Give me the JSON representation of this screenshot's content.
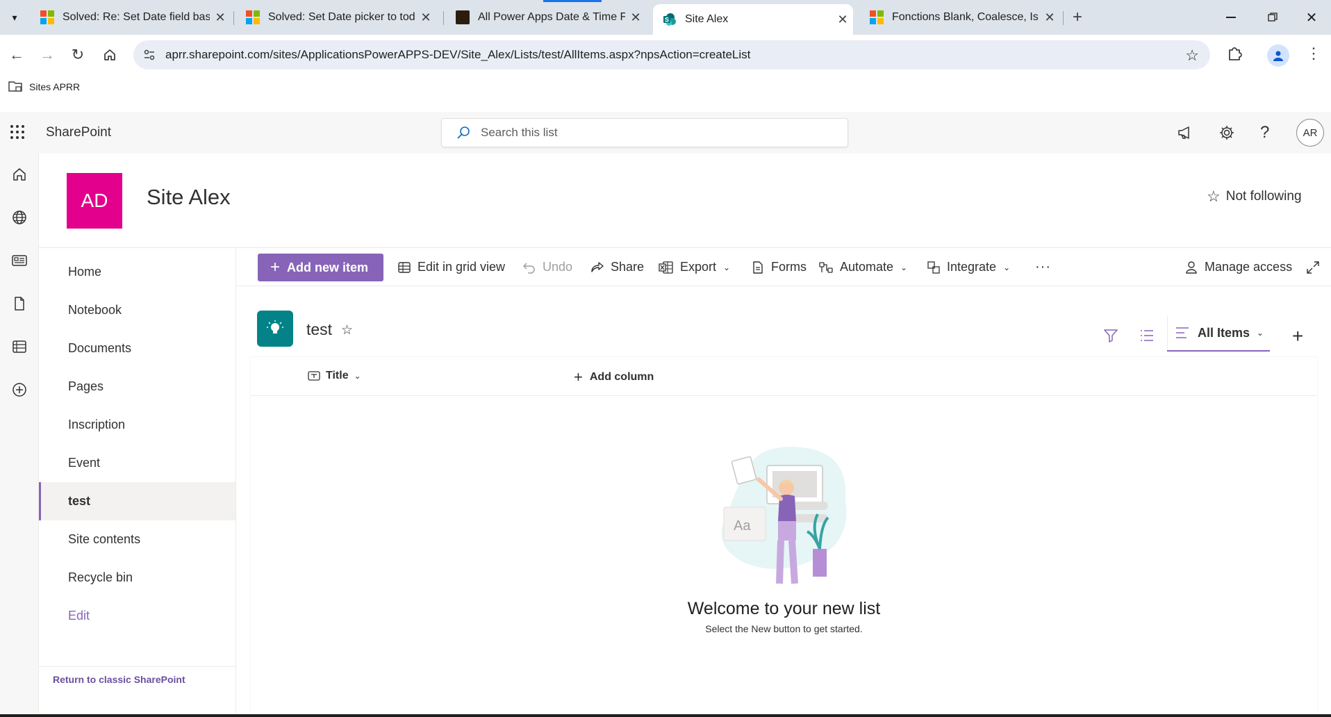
{
  "browser": {
    "tabs": [
      {
        "title": "Solved: Re: Set Date field based",
        "favicon": "microsoft-logo"
      },
      {
        "title": "Solved: Set Date picker to today",
        "favicon": "microsoft-logo"
      },
      {
        "title": "All Power Apps Date & Time Fu",
        "favicon": "site-favicon"
      },
      {
        "title": "Site Alex",
        "favicon": "sharepoint-logo"
      },
      {
        "title": "Fonctions Blank, Coalesce, IsBla",
        "favicon": "microsoft-logo"
      }
    ],
    "active_tab": 3,
    "url": "aprr.sharepoint.com/sites/ApplicationsPowerAPPS-DEV/Site_Alex/Lists/test/AllItems.aspx?npsAction=createList",
    "bookmark": "Sites APRR"
  },
  "suite": {
    "app_name": "SharePoint",
    "search_placeholder": "Search this list",
    "avatar": "AR"
  },
  "site": {
    "logo_text": "AD",
    "logo_color": "#e3008c",
    "title": "Site Alex",
    "follow_label": "Not following"
  },
  "nav": {
    "items": [
      "Home",
      "Notebook",
      "Documents",
      "Pages",
      "Inscription",
      "Event",
      "test",
      "Site contents",
      "Recycle bin",
      "Edit"
    ],
    "selected": "test",
    "classic_link": "Return to classic SharePoint"
  },
  "commands": {
    "add_new": "Add new item",
    "edit_grid": "Edit in grid view",
    "undo": "Undo",
    "share": "Share",
    "export": "Export",
    "forms": "Forms",
    "automate": "Automate",
    "integrate": "Integrate",
    "manage_access": "Manage access"
  },
  "list": {
    "title": "test",
    "view": "All Items",
    "columns": [
      "Title"
    ],
    "add_column": "Add column",
    "empty_title": "Welcome to your new list",
    "empty_subtitle": "Select the New button to get started.",
    "accent": "#8764b8",
    "icon_color": "#038387"
  }
}
